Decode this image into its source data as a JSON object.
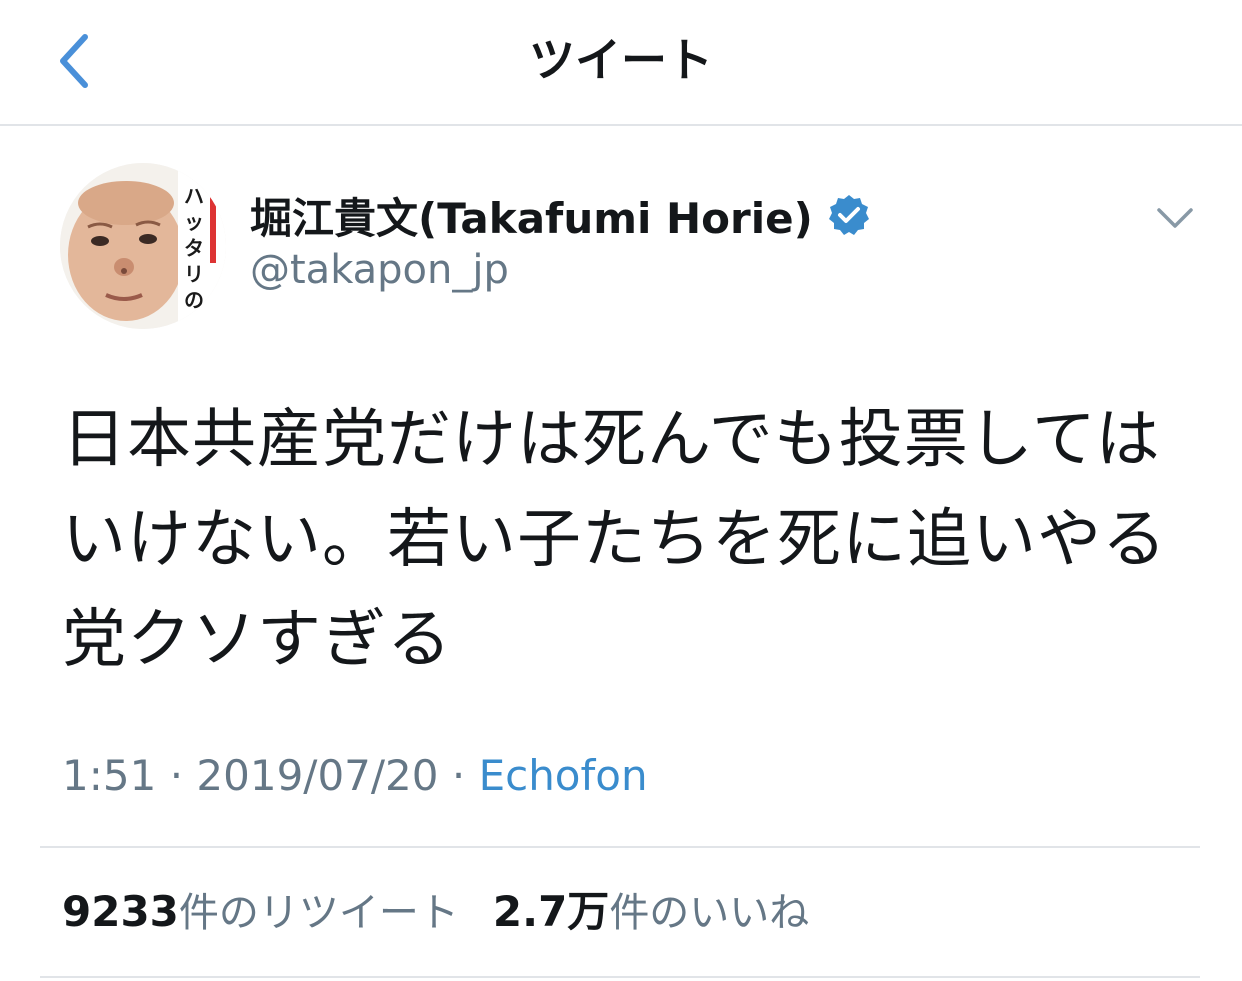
{
  "nav": {
    "title": "ツイート"
  },
  "author": {
    "display_name": "堀江貴文(Takafumi Horie)",
    "handle": "@takapon_jp",
    "verified": true,
    "avatar_book_title": "ハッタリの流"
  },
  "tweet": {
    "text": "日本共産党だけは死んでも投票してはいけない。若い子たちを死に追いやる党クソすぎる",
    "time": "1:51",
    "date": "2019/07/20",
    "separator": "·",
    "source": "Echofon"
  },
  "stats": {
    "retweet_count": "9233",
    "retweet_label": "件のリツイート",
    "like_count": "2.7万",
    "like_label": "件のいいね"
  },
  "colors": {
    "accent": "#4a90d9",
    "verified": "#3a8ccd",
    "text_primary": "#14171a",
    "text_secondary": "#657786",
    "divider": "#e1e4e8"
  }
}
